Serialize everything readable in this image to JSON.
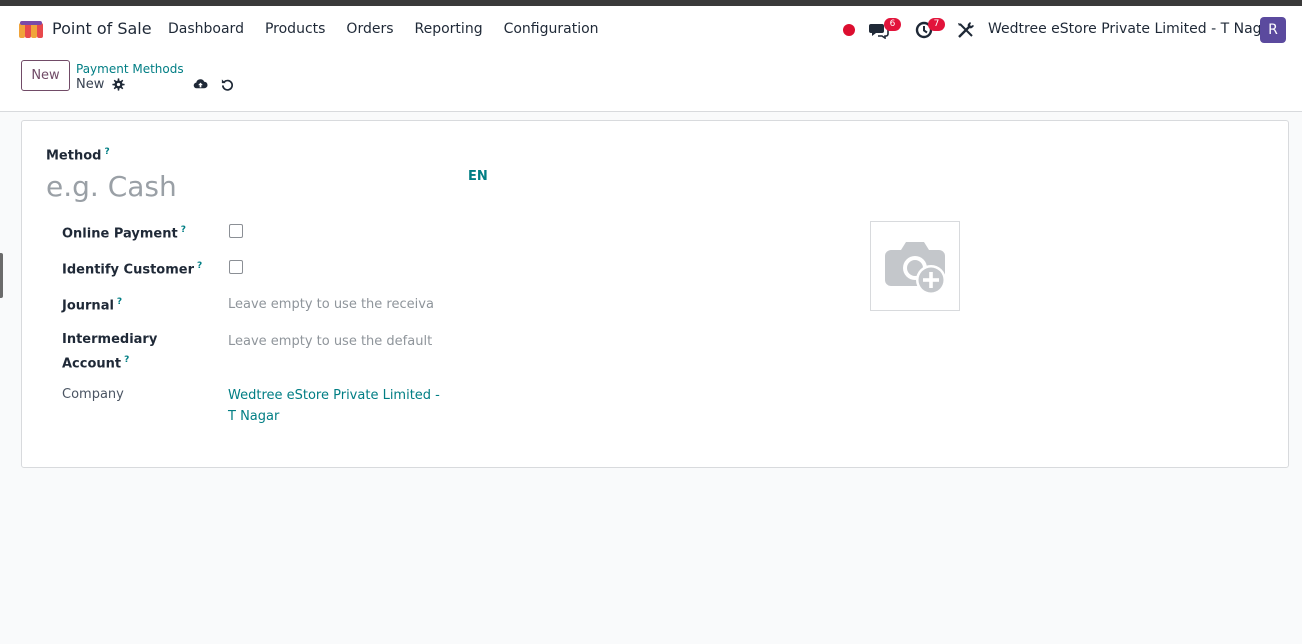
{
  "navbar": {
    "app_name": "Point of Sale",
    "menu": [
      "Dashboard",
      "Products",
      "Orders",
      "Reporting",
      "Configuration"
    ],
    "messages_count": "6",
    "activities_count": "7",
    "company": "Wedtree eStore Private Limited - T Nagar",
    "avatar_initial": "R",
    "icons": {
      "logo": "pos-store-icon",
      "recording": "record-dot-icon",
      "messages": "chat-icon",
      "activities": "clock-icon",
      "debug": "tools-icon"
    },
    "colors": {
      "accent": "#714b67",
      "badge": "#e2143b",
      "avatar": "#5b4a9e"
    }
  },
  "control_panel": {
    "new_label": "New",
    "breadcrumb_parent": "Payment Methods",
    "breadcrumb_current": "New",
    "icons": [
      "gear-icon",
      "cloud-upload-icon",
      "undo-icon"
    ]
  },
  "form": {
    "method_label": "Method",
    "method_help": "?",
    "method_placeholder": "e.g. Cash",
    "method_value": "",
    "lang_button": "EN",
    "fields": {
      "online_payment": {
        "label": "Online Payment",
        "help": "?",
        "checked": false
      },
      "identify_customer": {
        "label": "Identify Customer",
        "help": "?",
        "checked": false
      },
      "journal": {
        "label": "Journal",
        "help": "?",
        "placeholder": "Leave empty to use the receivable account of customer"
      },
      "intermediary_account": {
        "label_line1": "Intermediary",
        "label_line2": "Account",
        "help": "?",
        "placeholder": "Leave empty to use the default account from the company setting"
      },
      "company": {
        "label": "Company",
        "value": "Wedtree eStore Private Limited - T Nagar"
      }
    },
    "image_icon": "camera-plus-icon",
    "link_color": "#017e84"
  }
}
